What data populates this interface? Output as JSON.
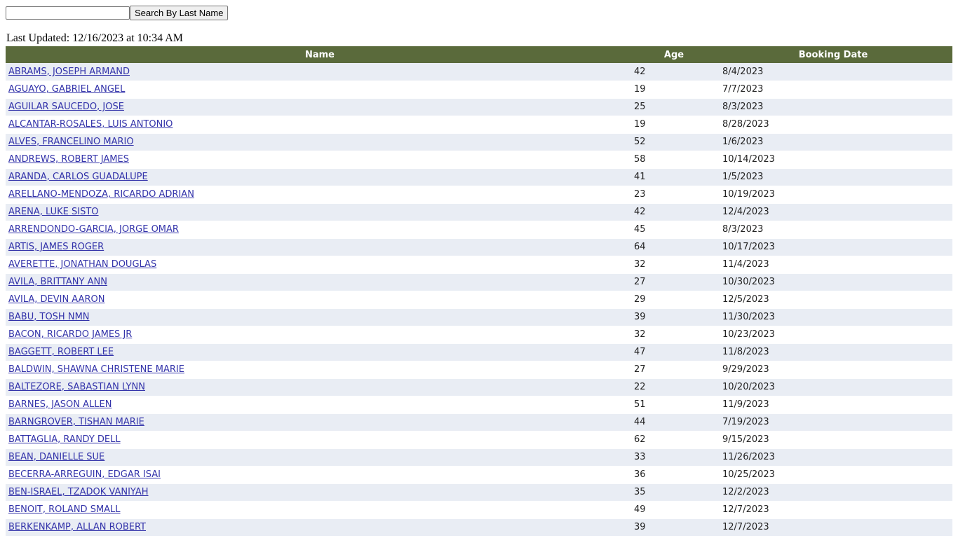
{
  "search": {
    "input_value": "",
    "button_label": "Search By Last Name"
  },
  "last_updated": "Last Updated: 12/16/2023 at 10:34 AM",
  "table": {
    "headers": {
      "name": "Name",
      "age": "Age",
      "booking_date": "Booking Date"
    },
    "rows": [
      {
        "name": "ABRAMS, JOSEPH ARMAND",
        "age": "42",
        "booking_date": "8/4/2023"
      },
      {
        "name": "AGUAYO, GABRIEL ANGEL",
        "age": "19",
        "booking_date": "7/7/2023"
      },
      {
        "name": "AGUILAR SAUCEDO, JOSE",
        "age": "25",
        "booking_date": "8/3/2023"
      },
      {
        "name": "ALCANTAR-ROSALES, LUIS ANTONIO",
        "age": "19",
        "booking_date": "8/28/2023"
      },
      {
        "name": "ALVES, FRANCELINO MARIO",
        "age": "52",
        "booking_date": "1/6/2023"
      },
      {
        "name": "ANDREWS, ROBERT JAMES",
        "age": "58",
        "booking_date": "10/14/2023"
      },
      {
        "name": "ARANDA, CARLOS GUADALUPE",
        "age": "41",
        "booking_date": "1/5/2023"
      },
      {
        "name": "ARELLANO-MENDOZA, RICARDO ADRIAN",
        "age": "23",
        "booking_date": "10/19/2023"
      },
      {
        "name": "ARENA, LUKE SISTO",
        "age": "42",
        "booking_date": "12/4/2023"
      },
      {
        "name": "ARRENDONDO-GARCIA, JORGE OMAR",
        "age": "45",
        "booking_date": "8/3/2023"
      },
      {
        "name": "ARTIS, JAMES ROGER",
        "age": "64",
        "booking_date": "10/17/2023"
      },
      {
        "name": "AVERETTE, JONATHAN DOUGLAS",
        "age": "32",
        "booking_date": "11/4/2023"
      },
      {
        "name": "AVILA, BRITTANY ANN",
        "age": "27",
        "booking_date": "10/30/2023"
      },
      {
        "name": "AVILA, DEVIN AARON",
        "age": "29",
        "booking_date": "12/5/2023"
      },
      {
        "name": "BABU, TOSH NMN",
        "age": "39",
        "booking_date": "11/30/2023"
      },
      {
        "name": "BACON, RICARDO JAMES JR",
        "age": "32",
        "booking_date": "10/23/2023"
      },
      {
        "name": "BAGGETT, ROBERT LEE",
        "age": "47",
        "booking_date": "11/8/2023"
      },
      {
        "name": "BALDWIN, SHAWNA CHRISTENE MARIE",
        "age": "27",
        "booking_date": "9/29/2023"
      },
      {
        "name": "BALTEZORE, SABASTIAN LYNN",
        "age": "22",
        "booking_date": "10/20/2023"
      },
      {
        "name": "BARNES, JASON ALLEN",
        "age": "51",
        "booking_date": "11/9/2023"
      },
      {
        "name": "BARNGROVER, TISHAN MARIE",
        "age": "44",
        "booking_date": "7/19/2023"
      },
      {
        "name": "BATTAGLIA, RANDY DELL",
        "age": "62",
        "booking_date": "9/15/2023"
      },
      {
        "name": "BEAN, DANIELLE SUE",
        "age": "33",
        "booking_date": "11/26/2023"
      },
      {
        "name": "BECERRA-ARREGUIN, EDGAR ISAI",
        "age": "36",
        "booking_date": "10/25/2023"
      },
      {
        "name": "BEN-ISRAEL, TZADOK VANIYAH",
        "age": "35",
        "booking_date": "12/2/2023"
      },
      {
        "name": "BENOIT, ROLAND SMALL",
        "age": "49",
        "booking_date": "12/7/2023"
      },
      {
        "name": "BERKENKAMP, ALLAN ROBERT",
        "age": "39",
        "booking_date": "12/7/2023"
      }
    ]
  },
  "colors": {
    "header_bg": "#5a6a3b",
    "row_alt_bg": "#e9edf4",
    "link": "#3333aa"
  }
}
